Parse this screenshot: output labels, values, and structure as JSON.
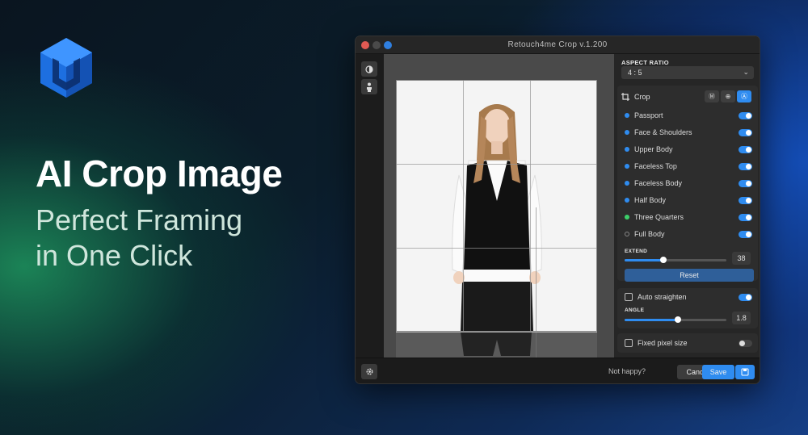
{
  "hero": {
    "logo": "cube-logo-icon",
    "headline": "AI Crop Image",
    "subline_1": "Perfect Framing",
    "subline_2": "in One Click"
  },
  "window": {
    "title": "Retouch4me Crop  v.1.200"
  },
  "left_tools": [
    "contrast-icon",
    "person-icon"
  ],
  "panel": {
    "aspect_ratio_label": "ASPECT RATIO",
    "aspect_ratio_value": "4 : 5",
    "crop_label": "Crop",
    "crop_modes": [
      "manual-mode-icon",
      "face-mode-icon",
      "auto-mode-icon"
    ],
    "crop_options": [
      {
        "label": "Passport",
        "on": true
      },
      {
        "label": "Face & Shoulders",
        "on": true
      },
      {
        "label": "Upper Body",
        "on": true
      },
      {
        "label": "Faceless Top",
        "on": true
      },
      {
        "label": "Faceless Body",
        "on": true
      },
      {
        "label": "Half Body",
        "on": true
      },
      {
        "label": "Three Quarters",
        "on": true
      },
      {
        "label": "Full Body",
        "on": true
      }
    ],
    "extend_label": "EXTEND",
    "extend_value": "38",
    "reset_label": "Reset",
    "auto_straighten_label": "Auto straighten",
    "auto_straighten_on": true,
    "angle_label": "ANGLE",
    "angle_value": "1.8",
    "fixed_pixel_label": "Fixed pixel size",
    "fixed_pixel_on": false
  },
  "footer": {
    "not_happy": "Not happy?",
    "cancel": "Cancel",
    "save": "Save"
  },
  "colors": {
    "accent": "#2f8cf0",
    "dot_green": "#3ccf6a"
  }
}
